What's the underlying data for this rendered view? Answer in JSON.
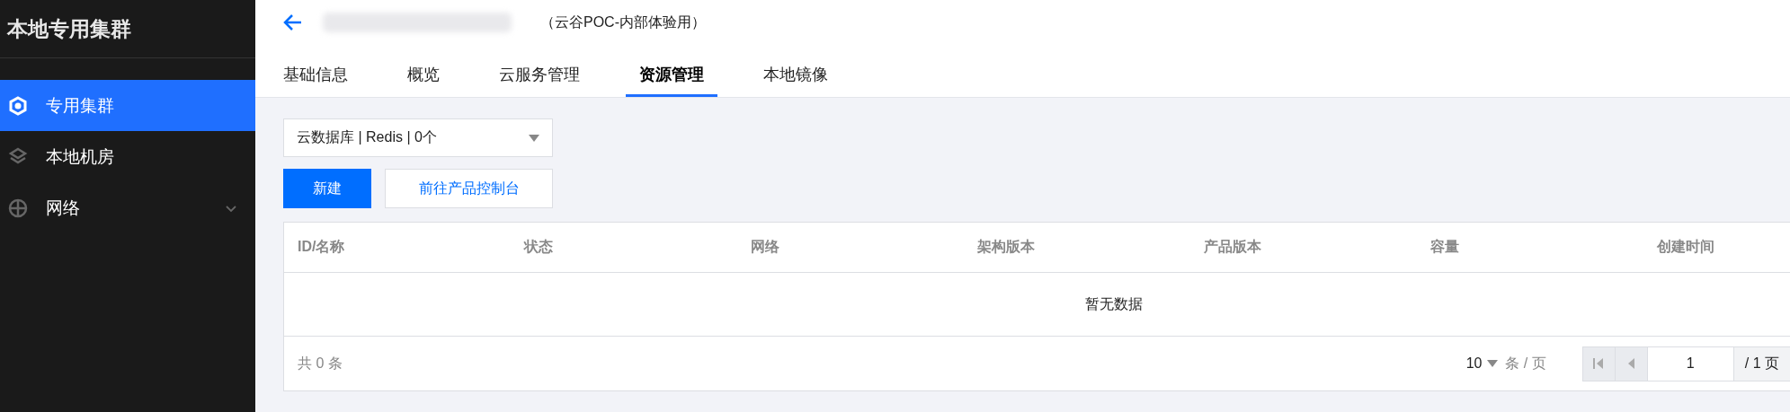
{
  "sidebar": {
    "title": "本地专用集群",
    "items": [
      {
        "label": "专用集群",
        "kind": "cluster",
        "selected": true
      },
      {
        "label": "本地机房",
        "kind": "room",
        "selected": false
      },
      {
        "label": "网络",
        "kind": "network",
        "selected": false,
        "expanded": false
      }
    ]
  },
  "header": {
    "subtitle": "（云谷POC-内部体验用）"
  },
  "tabs": [
    {
      "label": "基础信息",
      "selected": false
    },
    {
      "label": "概览",
      "selected": false
    },
    {
      "label": "云服务管理",
      "selected": false
    },
    {
      "label": "资源管理",
      "selected": true
    },
    {
      "label": "本地镜像",
      "selected": false
    }
  ],
  "resource_select": {
    "value": "云数据库 | Redis | 0个"
  },
  "buttons": [
    {
      "label": "新建",
      "kind": "primary"
    },
    {
      "label": "前往产品控制台",
      "kind": "secondary"
    }
  ],
  "table": {
    "columns": [
      "ID/名称",
      "状态",
      "网络",
      "架构版本",
      "产品版本",
      "容量",
      "创建时间"
    ],
    "empty_text": "暂无数据"
  },
  "footer": {
    "total": "共 0 条",
    "page_size": "10",
    "page_size_unit": "条 / 页",
    "first_disabled": true,
    "prev_disabled": true,
    "page": "1",
    "page_total": "/ 1 页"
  }
}
